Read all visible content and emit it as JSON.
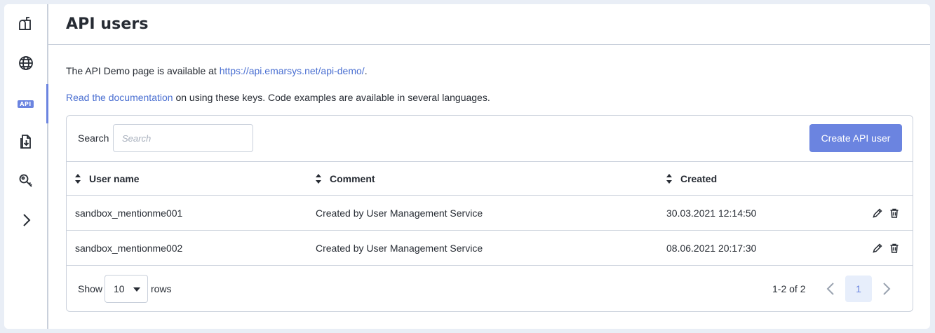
{
  "sidebar": {
    "items": [
      {
        "icon": "mailbox-icon"
      },
      {
        "icon": "globe-icon"
      },
      {
        "icon": "api-icon",
        "label": "API",
        "active": true
      },
      {
        "icon": "file-download-icon"
      },
      {
        "icon": "key-search-icon"
      },
      {
        "icon": "chevron-right-icon"
      }
    ]
  },
  "header": {
    "title": "API users"
  },
  "info": {
    "demo_prefix": "The API Demo page is available at ",
    "demo_link": "https://api.emarsys.net/api-demo/",
    "demo_suffix": ".",
    "doc_link": "Read the documentation",
    "doc_suffix": " on using these keys. Code examples are available in several languages."
  },
  "toolbar": {
    "search_label": "Search",
    "search_placeholder": "Search",
    "create_label": "Create API user"
  },
  "table": {
    "columns": [
      "User name",
      "Comment",
      "Created"
    ],
    "rows": [
      {
        "user": "sandbox_mentionme001",
        "comment": "Created by User Management Service",
        "created": "30.03.2021 12:14:50"
      },
      {
        "user": "sandbox_mentionme002",
        "comment": "Created by User Management Service",
        "created": "08.06.2021 20:17:30"
      }
    ]
  },
  "footer": {
    "show_label": "Show",
    "rows_value": "10",
    "rows_label": "rows",
    "range": "1-2 of 2",
    "current_page": "1"
  },
  "colors": {
    "accent": "#6b84e0",
    "link": "#4a6fd1",
    "border": "#c9d0db"
  }
}
